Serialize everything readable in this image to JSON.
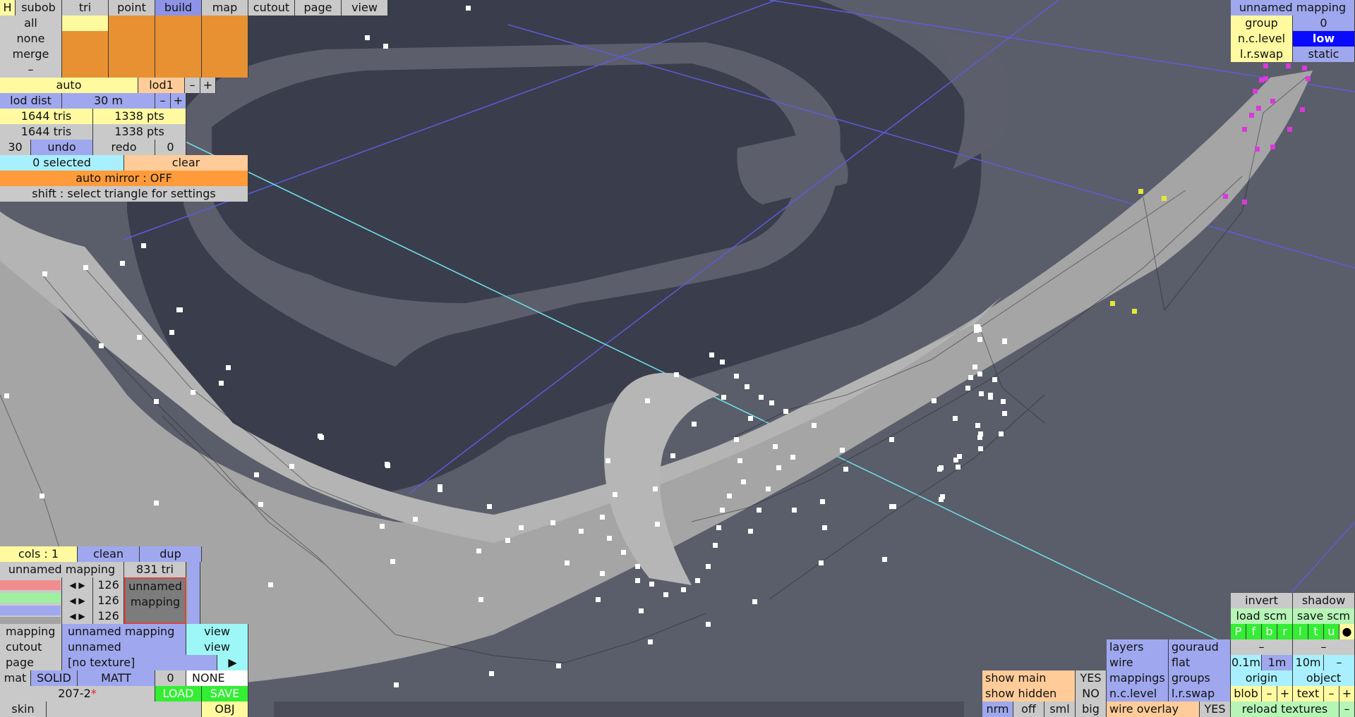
{
  "top_tabs": [
    "H",
    "subob",
    "tri",
    "point",
    "build",
    "map",
    "cutout",
    "page",
    "view"
  ],
  "active_tab": "build",
  "select_rows": [
    "all",
    "none",
    "merge",
    "–"
  ],
  "lod": {
    "auto": "auto",
    "level": "lod1",
    "minus": "–",
    "plus": "+",
    "dist_label": "lod dist",
    "dist_value": "30 m"
  },
  "stats": {
    "tris_a": "1644 tris",
    "pts_a": "1338 pts",
    "tris_b": "1644 tris",
    "pts_b": "1338 pts"
  },
  "undo": {
    "count": "30",
    "undo": "undo",
    "redo": "redo",
    "redo_count": "0"
  },
  "selection": {
    "selected": "0 selected",
    "clear": "clear"
  },
  "auto_mirror": "auto mirror : OFF",
  "hint": "shift : select triangle for settings",
  "mapping_panel": {
    "title": "unnamed mapping",
    "group_label": "group",
    "group_value": "0",
    "nc_label": "n.c.level",
    "nc_value": "low",
    "lr_label": "l.r.swap",
    "lr_value": "static"
  },
  "cols": {
    "label": "cols : 1",
    "clean": "clean",
    "dup": "dup"
  },
  "mapping_row": {
    "name": "unnamed mapping",
    "tri": "831 tri"
  },
  "rgb": {
    "r": "126",
    "g": "126",
    "b": "126",
    "preview": "unnamed mapping"
  },
  "bottom_left": {
    "mapping_label": "mapping",
    "mapping_value": "unnamed mapping",
    "view": "view",
    "cutout_label": "cutout",
    "cutout_value": "unnamed",
    "view2": "view",
    "page_label": "page",
    "page_value": "[no texture]",
    "play": "▶",
    "mat": "mat",
    "solid": "SOLID",
    "matt": "MATT",
    "mat_num": "0",
    "none": "NONE",
    "file": "207-2",
    "file_mark": "*",
    "load": "LOAD",
    "save": "SAVE",
    "skin": "skin",
    "obj": "OBJ"
  },
  "bottom_right": {
    "invert": "invert",
    "shadow": "shadow",
    "load_scm": "load scm",
    "save_scm": "save scm",
    "views": [
      "P",
      "f",
      "b",
      "r",
      "l",
      "t",
      "u",
      "●"
    ],
    "dash1": "–",
    "dash2": "–",
    "layers": "layers",
    "gouraud": "gouraud",
    "wire": "wire",
    "flat": "flat",
    "scale": [
      "0.1m",
      "1m",
      "10m",
      "–"
    ],
    "mappings": "mappings",
    "groups": "groups",
    "origin": "origin",
    "object": "object",
    "nc_level": "n.c.level",
    "lr_swap": "l.r.swap",
    "blob": "blob",
    "text": "text",
    "show_main": "show main",
    "show_main_v": "YES",
    "show_hidden": "show hidden",
    "show_hidden_v": "NO",
    "nrm": "nrm",
    "off": "off",
    "sml": "sml",
    "big": "big",
    "wire_overlay": "wire overlay",
    "wire_overlay_v": "YES",
    "reload": "reload textures",
    "reload_minus": "–"
  },
  "colors": {
    "viewport_bg": "#5a5d6a",
    "dark_panel": "#3a3d4c",
    "mesh": "#a9a9a9"
  }
}
